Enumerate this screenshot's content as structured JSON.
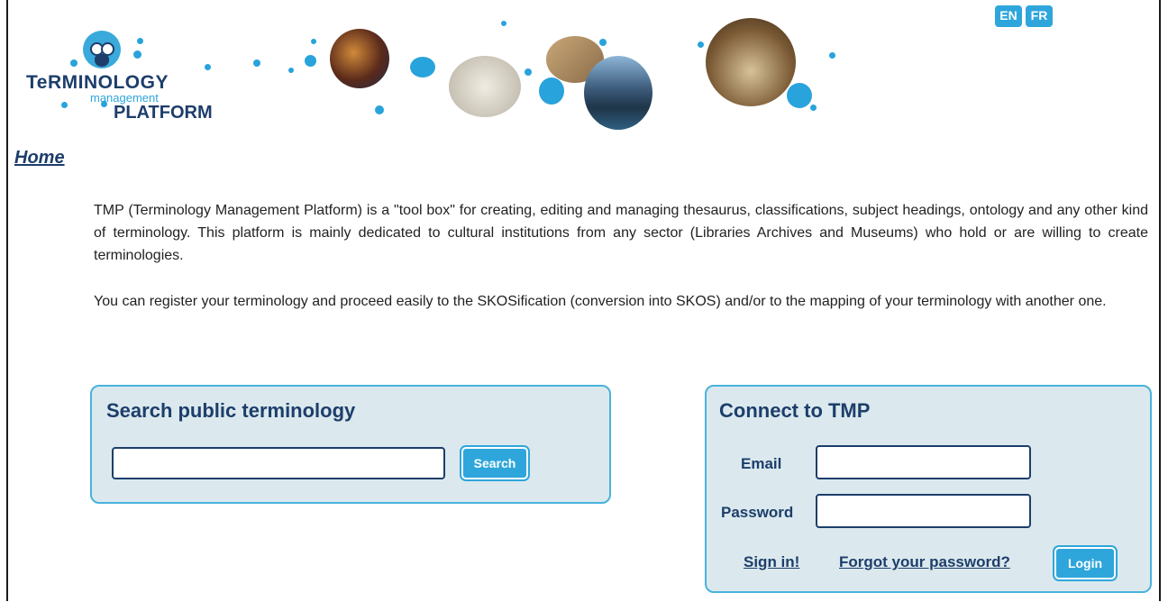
{
  "header": {
    "languages": [
      "EN",
      "FR"
    ],
    "logo": {
      "line1": "TeRMINOLOGY",
      "line2": "management",
      "line3": "PLATFORM"
    }
  },
  "breadcrumb": {
    "home": "Home"
  },
  "intro": {
    "paragraph1": "TMP (Terminology Management Platform) is a \"tool box\" for creating, editing and managing thesaurus, classifications, subject headings, ontology and any other kind of terminology. This platform is mainly dedicated to cultural institutions from any sector (Libraries Archives and Museums) who hold or are willing to create terminologies.",
    "paragraph2": "You can register your terminology and proceed easily to the SKOSification (conversion into SKOS) and/or to the mapping of your terminology with another one."
  },
  "search": {
    "title": "Search public terminology",
    "input_value": "",
    "button_label": "Search"
  },
  "connect": {
    "title": "Connect to TMP",
    "email_label": "Email",
    "email_value": "",
    "password_label": "Password",
    "password_value": "",
    "signin_label": "Sign in!",
    "forgot_label": "Forgot your password?",
    "login_label": "Login"
  },
  "colors": {
    "accent": "#2ea6dc",
    "navy": "#1d3e6b",
    "panel_bg": "#dbe9ee"
  }
}
